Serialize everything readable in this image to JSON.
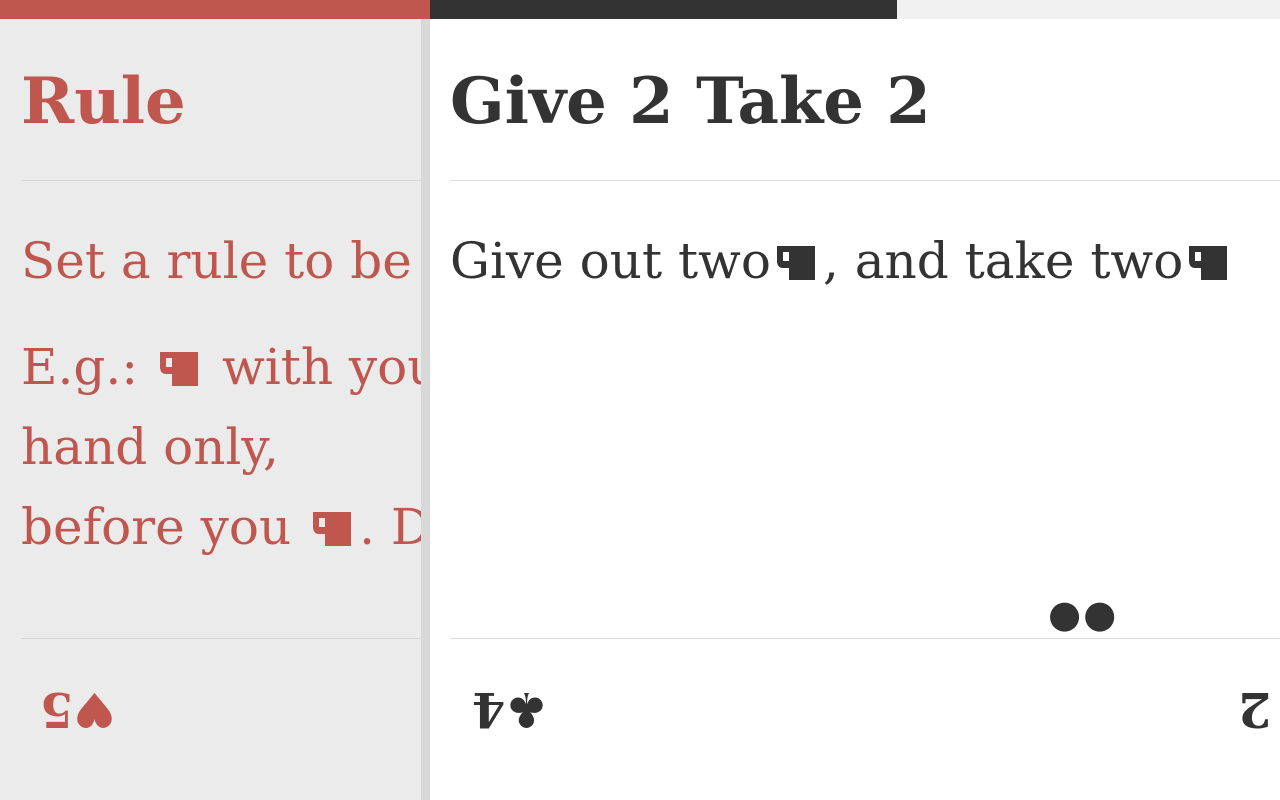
{
  "colors": {
    "accent": "#c0574f",
    "dark": "#333333",
    "empty": "#f0f0f0",
    "divider": "#cfcfcf"
  },
  "progress": {
    "segments": [
      "red",
      "dark",
      "empty"
    ]
  },
  "left_card": {
    "title": "Rule",
    "line1": "Set a rule to be followed.",
    "example_prefix": "E.g.:",
    "example_mid": "with your left hand only,",
    "example_line2_start": "before you",
    "example_end": ". Do",
    "footer_value": "5",
    "footer_suit": "♥",
    "drink_icon": "mug-icon"
  },
  "right_card": {
    "title": "Give 2 Take 2",
    "line_a": "Give out two",
    "line_b": ", and take two",
    "dots": "●●",
    "footer_value": "4",
    "footer_suit": "♣",
    "corner_value": "2",
    "drink_icon": "mug-icon"
  }
}
